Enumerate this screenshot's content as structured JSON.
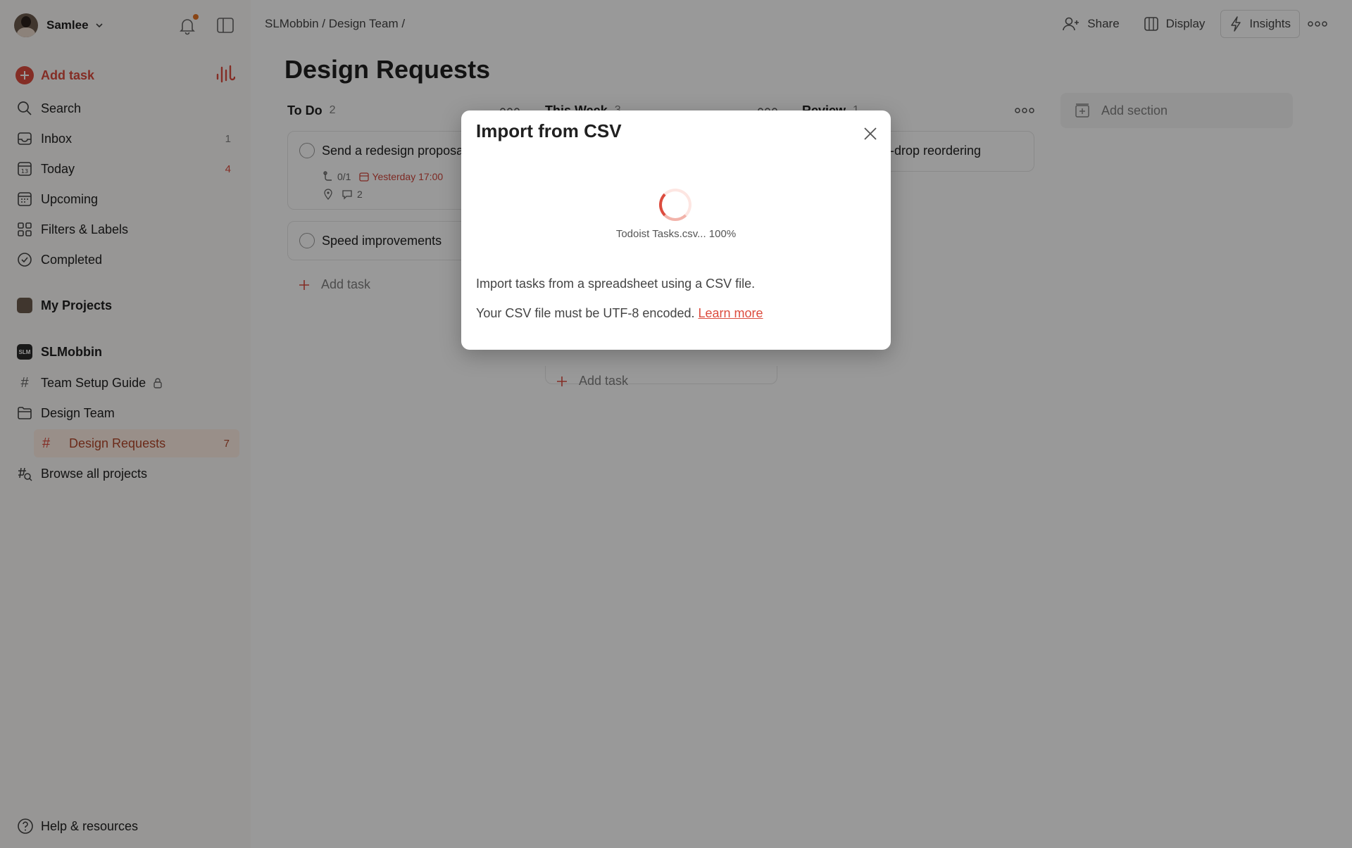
{
  "sidebar": {
    "user_name": "Samlee",
    "add_task_label": "Add task",
    "nav": [
      {
        "label": "Search",
        "count": ""
      },
      {
        "label": "Inbox",
        "count": "1"
      },
      {
        "label": "Today",
        "count": "4"
      },
      {
        "label": "Upcoming",
        "count": ""
      },
      {
        "label": "Filters & Labels",
        "count": ""
      },
      {
        "label": "Completed",
        "count": ""
      }
    ],
    "today_day": "13",
    "my_projects": "My Projects",
    "workspace": "SLMobbin",
    "workspace_icon_text": "SLM",
    "projects": [
      {
        "label": "Team Setup Guide"
      },
      {
        "label": "Design Team"
      }
    ],
    "active_project": {
      "label": "Design Requests",
      "count": "7"
    },
    "browse": "Browse all projects",
    "help": "Help & resources"
  },
  "header": {
    "breadcrumb": "SLMobbin / Design Team /",
    "share": "Share",
    "display": "Display",
    "insights": "Insights"
  },
  "main": {
    "title": "Design Requests",
    "columns": [
      {
        "name": "To Do",
        "count": "2"
      },
      {
        "name": "This Week",
        "count": "3"
      },
      {
        "name": "Review",
        "count": "1"
      }
    ],
    "todo_cards": [
      {
        "title": "Send a redesign proposa",
        "subtasks": "0/1",
        "due": "Yesterday 17:00",
        "comments": "2"
      },
      {
        "title": "Speed improvements"
      }
    ],
    "review_card_title": "l-drop reordering",
    "add_task": "Add task",
    "add_section": "Add section"
  },
  "modal": {
    "title": "Import from CSV",
    "progress": "Todoist Tasks.csv... 100%",
    "line1": "Import tasks from a spreadsheet using a CSV file.",
    "line2": "Your CSV file must be UTF-8 encoded.",
    "link": "Learn more"
  },
  "colors": {
    "accent": "#dc4c3e",
    "sidebar_bg": "#fcfaf8",
    "active_bg": "#ffefe5",
    "overlay": "rgba(0,0,0,0.4)"
  }
}
